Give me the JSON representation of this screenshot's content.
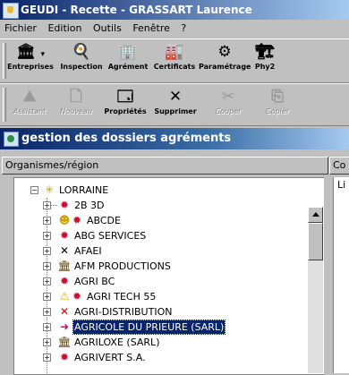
{
  "window": {
    "title": "GEUDI - Recette - GRASSART Laurence"
  },
  "menu": [
    "Fichier",
    "Edition",
    "Outils",
    "Fenêtre",
    "?"
  ],
  "toolbar1": [
    {
      "label": "Entreprises",
      "icon": "building-icon",
      "glyph": "🏛"
    },
    {
      "label": "Inspection",
      "icon": "inspection-icon",
      "glyph": "🍳"
    },
    {
      "label": "Agrément",
      "icon": "approval-icon",
      "glyph": "🏢"
    },
    {
      "label": "Certificats",
      "icon": "certificate-icon",
      "glyph": "🏭"
    },
    {
      "label": "Paramétrage",
      "icon": "settings-icon",
      "glyph": "⚙"
    },
    {
      "label": "Phy2",
      "icon": "phy2-icon",
      "glyph": "🏗"
    }
  ],
  "toolbar2": [
    {
      "label": "Assistant",
      "icon": "wizard-icon",
      "glyph": "⛰",
      "enabled": false
    },
    {
      "label": "Nouveau",
      "icon": "new-document-icon",
      "glyph": "🗋",
      "enabled": false
    },
    {
      "label": "Propriétés",
      "icon": "properties-icon",
      "glyph": "🗔",
      "enabled": true
    },
    {
      "label": "Supprimer",
      "icon": "delete-icon",
      "glyph": "✕",
      "enabled": true
    },
    {
      "label": "Couper",
      "icon": "cut-icon",
      "glyph": "✂",
      "enabled": false
    },
    {
      "label": "Copier",
      "icon": "copy-icon",
      "glyph": "⎘",
      "enabled": false
    }
  ],
  "panel": {
    "title": "gestion des dossiers agréments",
    "column_left": "Organismes/région",
    "column_right": "Co",
    "right_first_cell": "Li"
  },
  "tree": {
    "root": {
      "label": "LORRAINE",
      "icon": "region-icon"
    },
    "items": [
      {
        "label": "2B 3D",
        "icon": "factory-icon"
      },
      {
        "label": "ABCDE",
        "icon": "status-warning-factory-icon"
      },
      {
        "label": "ABG SERVICES",
        "icon": "factory-icon"
      },
      {
        "label": "AFAEI",
        "icon": "cross-icon"
      },
      {
        "label": "AFM PRODUCTIONS",
        "icon": "building-icon"
      },
      {
        "label": "AGRI BC",
        "icon": "factory-icon"
      },
      {
        "label": "AGRI TECH 55",
        "icon": "warning-factory-icon"
      },
      {
        "label": "AGRI-DISTRIBUTION",
        "icon": "red-cross-icon"
      },
      {
        "label": "AGRICOLE DU PRIEURE (SARL)",
        "icon": "arrow-right-icon",
        "selected": true
      },
      {
        "label": "AGRILOXE (SARL)",
        "icon": "building-icon"
      },
      {
        "label": "AGRIVERT S.A.",
        "icon": "factory-icon"
      }
    ]
  }
}
